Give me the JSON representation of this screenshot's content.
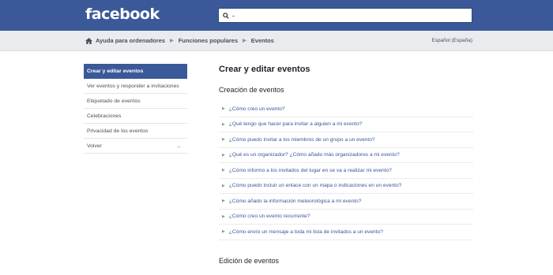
{
  "header": {
    "logo": "facebook",
    "search_value": "-"
  },
  "breadcrumb": {
    "items": [
      "Ayuda para ordenadores",
      "Funciones populares",
      "Eventos"
    ],
    "language": "Español (España)"
  },
  "sidebar": {
    "items": [
      {
        "label": "Crear y editar eventos",
        "active": true
      },
      {
        "label": "Ver eventos y responder a invitaciones"
      },
      {
        "label": "Etiquetado de eventos"
      },
      {
        "label": "Celebraciones"
      },
      {
        "label": "Privacidad de los eventos"
      },
      {
        "label": "Volver"
      }
    ]
  },
  "main": {
    "title": "Crear y editar eventos",
    "sections": [
      {
        "title": "Creación de eventos",
        "questions": [
          "¿Cómo creo un evento?",
          "¿Qué tengo que hacer para invitar a alguien a mi evento?",
          "¿Cómo puedo invitar a los miembros de un grupo a un evento?",
          "¿Qué es un organizador? ¿Cómo añado más organizadores a mi evento?",
          "¿Cómo informo a los invitados del lugar en se va a realizar mi evento?",
          "¿Cómo puedo incluir un enlace con un mapa o indicaciones en un evento?",
          "¿Cómo añado la información meteorológica a mi evento?",
          "¿Cómo creo un evento recurrente?",
          "¿Cómo envío un mensaje a toda mi lista de invitados a un evento?"
        ]
      },
      {
        "title": "Edición de eventos"
      }
    ]
  }
}
